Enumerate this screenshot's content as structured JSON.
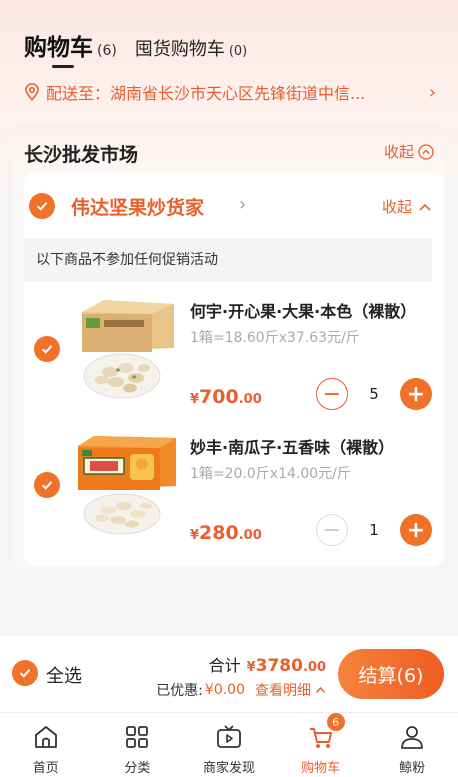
{
  "header": {
    "tab_cart": "购物车",
    "tab_cart_count": "(6)",
    "tab_stock": "囤货购物车",
    "tab_stock_count": "(0)"
  },
  "address": {
    "text": "配送至：湖南省长沙市天心区先锋街道中信..."
  },
  "market": {
    "name": "长沙批发市场",
    "collapse_label": "收起"
  },
  "shop": {
    "name": "伟达坚果炒货家",
    "collapse_label": "收起",
    "promo_note": "以下商品不参加任何促销活动"
  },
  "items": [
    {
      "name": "何宇·开心果·大果·本色（裸散）",
      "spec": "1箱=18.60斤x37.63元/斤",
      "price_currency": "¥",
      "price_int": "700",
      "price_dec": ".00",
      "quantity": "5",
      "minus_enabled": true
    },
    {
      "name": "妙丰·南瓜子·五香味（裸散）",
      "spec": "1箱=20.0斤x14.00元/斤",
      "price_currency": "¥",
      "price_int": "280",
      "price_dec": ".00",
      "quantity": "1",
      "minus_enabled": false
    }
  ],
  "checkout": {
    "select_all": "全选",
    "total_label": "合计",
    "total_currency": "¥",
    "total_int": "3780",
    "total_dec": ".00",
    "discount_label": "已优惠:",
    "discount_value": "¥0.00",
    "detail_link": "查看明细",
    "button_label": "结算(6)"
  },
  "tabbar": {
    "items": [
      {
        "label": "首页",
        "icon": "home-icon"
      },
      {
        "label": "分类",
        "icon": "grid-icon"
      },
      {
        "label": "商家发现",
        "icon": "tv-icon"
      },
      {
        "label": "购物车",
        "icon": "cart-icon",
        "badge": "6"
      },
      {
        "label": "鲸粉",
        "icon": "person-icon"
      }
    ]
  },
  "colors": {
    "accent": "#f07228",
    "accent_text": "#e9602e"
  }
}
